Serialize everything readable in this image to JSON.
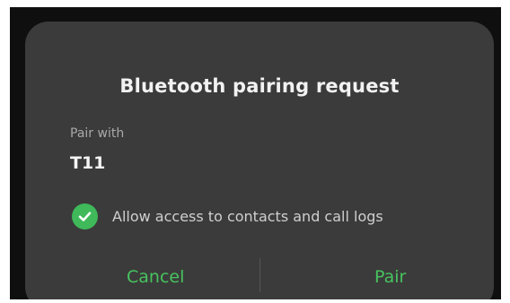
{
  "dialog": {
    "title": "Bluetooth pairing request",
    "pair_label": "Pair with",
    "device_name": "T11",
    "checkbox": {
      "label": "Allow access to contacts and call logs",
      "checked": true
    },
    "buttons": {
      "cancel": "Cancel",
      "pair": "Pair"
    }
  },
  "colors": {
    "accent": "#47c35f",
    "dialog_bg": "#3b3b3b",
    "screen_bg": "#0f0f0f"
  }
}
